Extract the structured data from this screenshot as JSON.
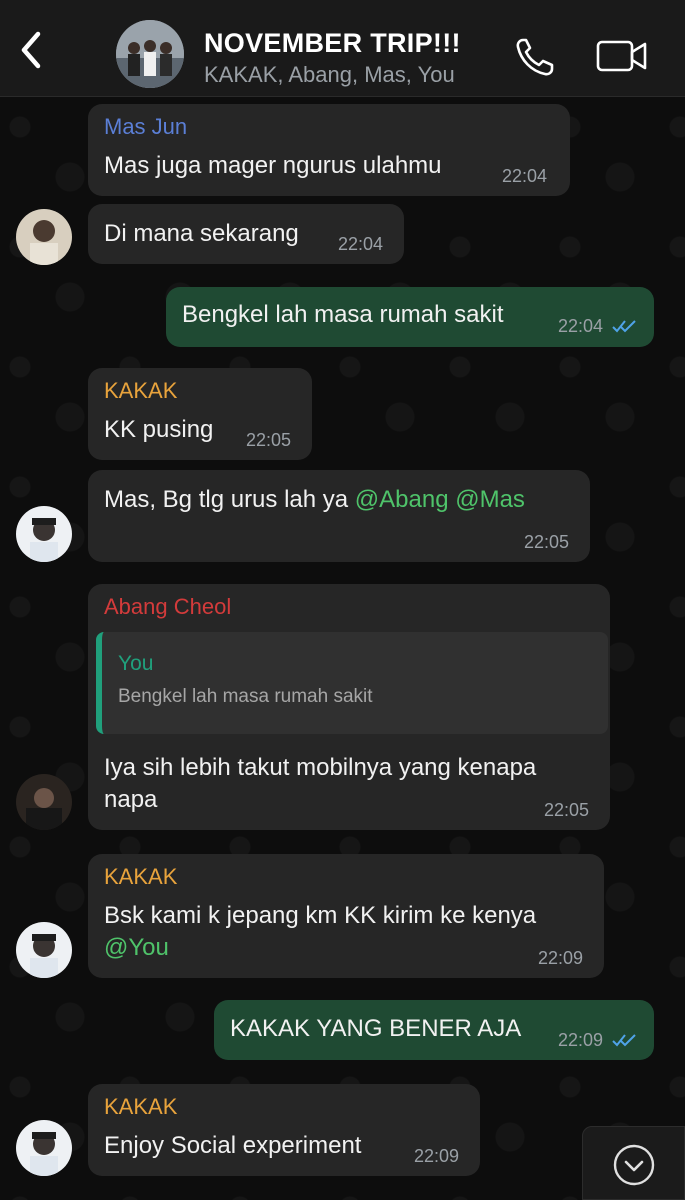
{
  "header": {
    "title": "NOVEMBER TRIP!!!",
    "subtitle": "KAKAK, Abang, Mas, You"
  },
  "colors": {
    "incoming_bubble": "#262626",
    "outgoing_bubble": "#1f4a33",
    "mas_jun": "#5b7fd6",
    "kakak": "#e8a33c",
    "abang_cheol": "#d33b3b",
    "mention": "#4fc36a",
    "quote_accent": "#20a07c"
  },
  "messages": [
    {
      "sender": "Mas Jun",
      "text": "Mas juga mager ngurus ulahmu",
      "time": "22:04"
    },
    {
      "sender": "",
      "text": "Di mana sekarang",
      "time": "22:04"
    },
    {
      "sender": "You",
      "text": "Bengkel lah masa rumah sakit",
      "time": "22:04"
    },
    {
      "sender": "KAKAK",
      "text": "KK pusing",
      "time": "22:05"
    },
    {
      "sender": "",
      "text_prefix": "Mas, Bg tlg urus lah ya ",
      "mention1": "@Abang",
      "mention2": "@Mas",
      "time": "22:05"
    },
    {
      "sender": "Abang Cheol",
      "quote_author": "You",
      "quote_text": "Bengkel lah masa rumah sakit",
      "line1": "Iya sih lebih takut mobilnya yang kenapa",
      "line2": "napa",
      "time": "22:05"
    },
    {
      "sender": "KAKAK",
      "line1": "Bsk kami k jepang km KK kirim ke kenya",
      "mention": "@You",
      "time": "22:09"
    },
    {
      "sender": "You",
      "text": "KAKAK YANG BENER AJA",
      "time": "22:09"
    },
    {
      "sender": "KAKAK",
      "text": "Enjoy Social experiment",
      "time": "22:09"
    }
  ]
}
